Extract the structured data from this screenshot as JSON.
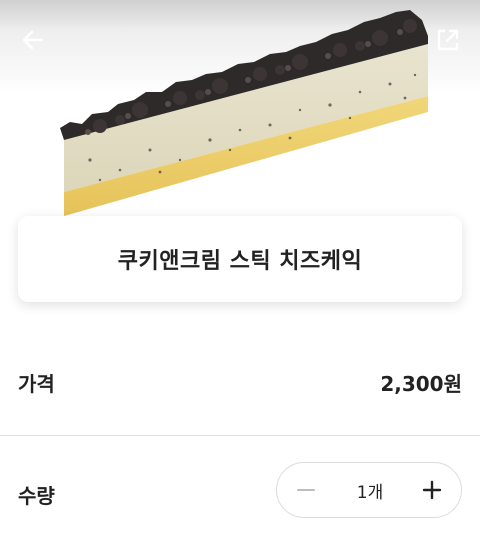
{
  "header": {
    "back_icon": "arrow-left-icon",
    "share_icon": "external-share-icon"
  },
  "product": {
    "image": "cookie-cream-stick-cheesecake-photo",
    "name": "쿠키앤크림 스틱 치즈케익"
  },
  "price": {
    "label": "가격",
    "value": "2,300원"
  },
  "quantity": {
    "label": "수량",
    "value": "1개",
    "minus_icon": "minus-icon",
    "plus_icon": "plus-icon",
    "minus_color": "#bdbdbd",
    "plus_color": "#222222"
  }
}
